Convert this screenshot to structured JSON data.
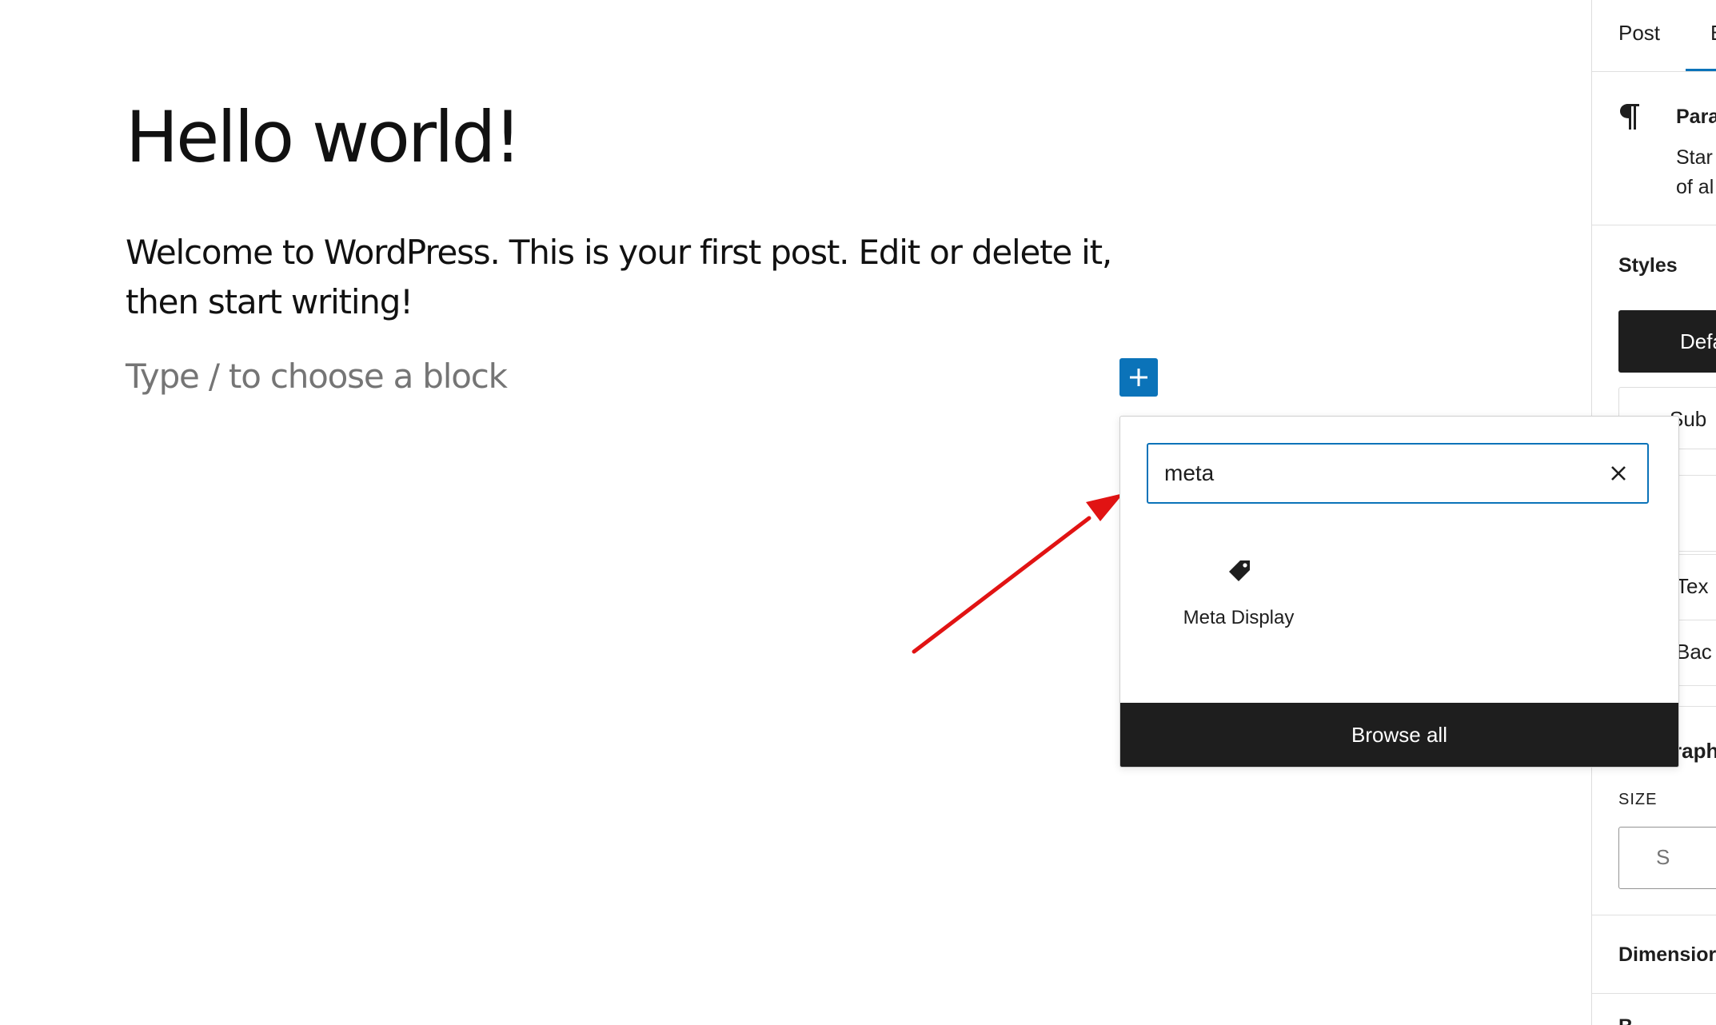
{
  "post": {
    "title": "Hello world!",
    "paragraph": "Welcome to WordPress. This is your first post. Edit or delete it, then start writing!",
    "placeholder": "Type / to choose a block"
  },
  "inserter": {
    "search_value": "meta",
    "results": [
      {
        "label": "Meta Display",
        "icon": "tag-icon"
      }
    ],
    "browse_all_label": "Browse all"
  },
  "sidebar": {
    "tabs": [
      "Post",
      "B"
    ],
    "active_tab_index": 1,
    "block": {
      "icon": "paragraph-icon",
      "name": "Para",
      "description_lines": [
        "Star",
        "of al"
      ]
    },
    "styles_title": "Styles",
    "style_options": [
      "Defa",
      "Sub"
    ],
    "color_items": [
      "Tex",
      "Bac"
    ],
    "typography_title": "raph",
    "size_label": "SIZE",
    "size_value": "S",
    "dimensions_title": "Dimensior",
    "next_title": "B"
  },
  "colors": {
    "accent": "#0b73b9",
    "dark": "#1e1e1e",
    "annotation_arrow": "#e11313"
  }
}
